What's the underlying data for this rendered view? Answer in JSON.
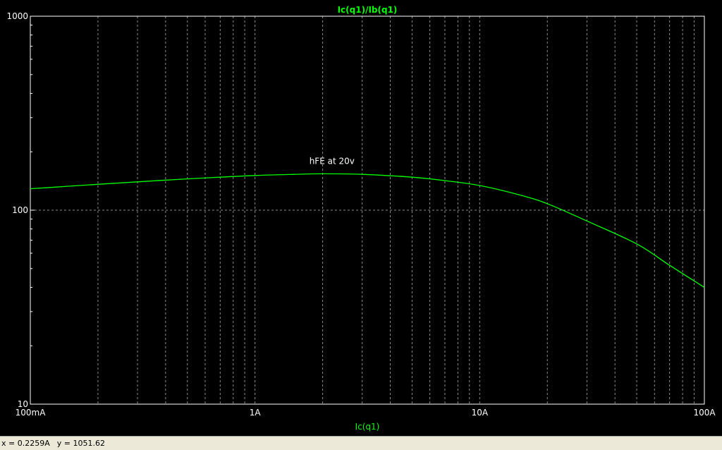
{
  "chart_data": {
    "type": "line",
    "title": "Ic(q1)/Ib(q1)",
    "xlabel": "Ic(q1)",
    "ylabel": "",
    "xscale": "log",
    "yscale": "log",
    "xlim": [
      0.1,
      100
    ],
    "ylim": [
      10,
      1000
    ],
    "grid": true,
    "x_ticks": [
      {
        "value": 0.1,
        "label": "100mA"
      },
      {
        "value": 1,
        "label": "1A"
      },
      {
        "value": 10,
        "label": "10A"
      },
      {
        "value": 100,
        "label": "100A"
      }
    ],
    "y_ticks": [
      {
        "value": 10,
        "label": "10"
      },
      {
        "value": 100,
        "label": "100"
      },
      {
        "value": 1000,
        "label": "1000"
      }
    ],
    "series": [
      {
        "name": "Ic(q1)/Ib(q1)",
        "color": "#00ff00",
        "x": [
          0.1,
          0.15,
          0.2,
          0.3,
          0.5,
          0.7,
          1,
          1.5,
          2,
          3,
          5,
          7,
          10,
          15,
          20,
          30,
          50,
          70,
          100
        ],
        "y": [
          129,
          133,
          136,
          140,
          145,
          148,
          151,
          153,
          154,
          153,
          148,
          142,
          134,
          120,
          108,
          88,
          67,
          52,
          40
        ]
      }
    ],
    "annotations": [
      {
        "text": "hFE at 20v",
        "x": 2.2,
        "y": 173
      }
    ]
  },
  "colors": {
    "background": "#000000",
    "axis": "#ffffff",
    "grid": "#8c8c8c",
    "title": "#00ff00",
    "text": "#ffffff",
    "xlabel": "#00ff00"
  },
  "status": {
    "x_readout": "x = 0.2259A",
    "y_readout": "y = 1051.62"
  }
}
